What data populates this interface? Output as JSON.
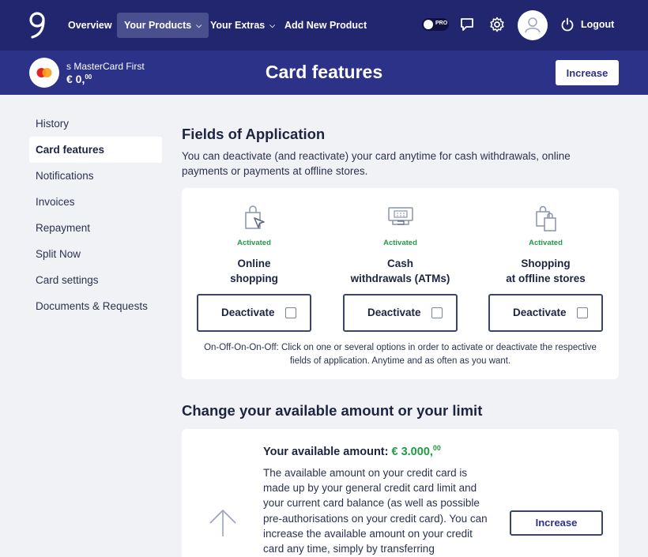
{
  "nav": {
    "overview": "Overview",
    "your_products": "Your Products",
    "your_extras": "Your Extras",
    "add_new_product": "Add New Product",
    "pro_label": "PRO",
    "logout": "Logout"
  },
  "card": {
    "name": "s MasterCard First",
    "balance_main": "€ 0,",
    "balance_cents": "00",
    "increase_label": "Increase"
  },
  "page_title": "Card features",
  "sidebar": {
    "items": [
      {
        "label": "History"
      },
      {
        "label": "Card features",
        "active": true
      },
      {
        "label": "Notifications"
      },
      {
        "label": "Invoices"
      },
      {
        "label": "Repayment"
      },
      {
        "label": "Split Now"
      },
      {
        "label": "Card settings"
      },
      {
        "label": "Documents & Requests"
      }
    ]
  },
  "fields": {
    "title": "Fields of Application",
    "description": "You can deactivate (and reactivate) your card anytime for cash withdrawals, online payments or payments at offline stores.",
    "features": [
      {
        "status": "Activated",
        "name_line1": "Online",
        "name_line2": "shopping",
        "button": "Deactivate",
        "icon": "shopping-bag-cursor-icon"
      },
      {
        "status": "Activated",
        "name_line1": "Cash",
        "name_line2": "withdrawals (ATMs)",
        "button": "Deactivate",
        "icon": "atm-icon"
      },
      {
        "status": "Activated",
        "name_line1": "Shopping",
        "name_line2": "at offline stores",
        "button": "Deactivate",
        "icon": "shopping-bags-icon"
      }
    ],
    "note": "On-Off-On-On-Off: Click on one or several options in order to activate or deactivate the respective fields of application. Anytime and as often as you want."
  },
  "limit": {
    "title": "Change your available amount or your limit",
    "amount_label": "Your available amount:",
    "amount_value": "€ 3.000,",
    "amount_cents": "00",
    "text": "The available amount on your credit card is made up by your general credit card limit and your current card balance (as well as possible pre-authorisations on your credit card). You can increase the available amount on your credit card any time, simply by transferring",
    "button": "Increase"
  },
  "colors": {
    "nav_bg": "#22266e",
    "cardbar_bg": "#2d3289",
    "activated_green": "#1f9c45",
    "page_bg": "#f1f2f5"
  }
}
